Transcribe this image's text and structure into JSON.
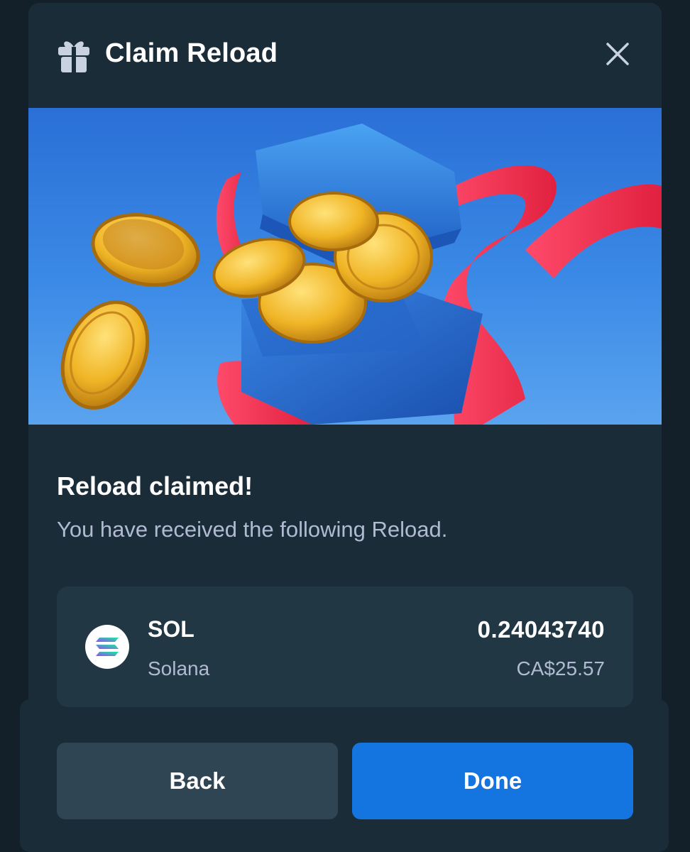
{
  "modal": {
    "title": "Claim Reload",
    "icons": {
      "header": "gift-icon",
      "close": "close-icon"
    }
  },
  "banner": {
    "description_icon": "gift-box-with-coins-illustration"
  },
  "content": {
    "heading": "Reload claimed!",
    "subtext": "You have received the following Reload."
  },
  "asset": {
    "symbol": "SOL",
    "name": "Solana",
    "amount": "0.24043740",
    "fiat_value": "CA$25.57",
    "icon": "solana-icon"
  },
  "buttons": {
    "back": "Back",
    "done": "Done"
  },
  "colors": {
    "modal_bg": "#1a2c38",
    "card_bg": "#213743",
    "back_button": "#2f4553",
    "done_button": "#1475e1",
    "muted_text": "#b1bad3"
  }
}
